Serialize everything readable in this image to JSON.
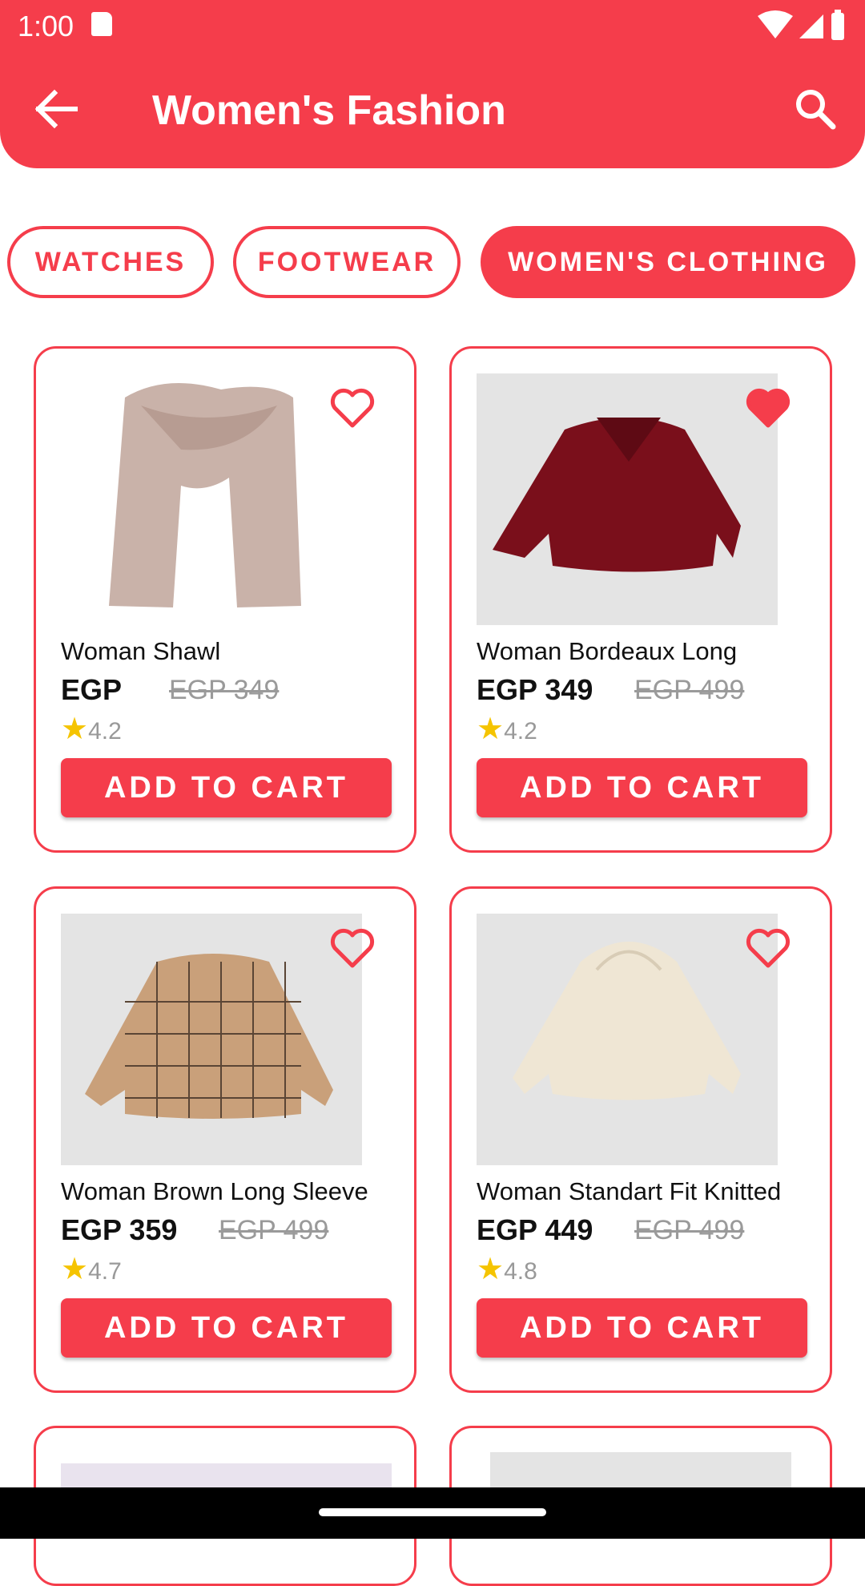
{
  "status": {
    "time": "1:00"
  },
  "header": {
    "title": "Women's Fashion"
  },
  "chips": [
    {
      "label": "WATCHES",
      "active": false
    },
    {
      "label": "FOOTWEAR",
      "active": false
    },
    {
      "label": "WOMEN'S CLOTHING",
      "active": true
    }
  ],
  "products": [
    {
      "name": "Woman Shawl",
      "price": "EGP",
      "old_price": "EGP 349",
      "rating": "4.2",
      "favorite": false,
      "button": "ADD TO CART",
      "image_color": "#c9b2a9"
    },
    {
      "name": "Woman Bordeaux Long",
      "price": "EGP 349",
      "old_price": "EGP 499",
      "rating": "4.2",
      "favorite": true,
      "button": "ADD TO CART",
      "image_color": "#7a0f1b"
    },
    {
      "name": "Woman Brown Long Sleeve",
      "price": "EGP 359",
      "old_price": "EGP 499",
      "rating": "4.7",
      "favorite": false,
      "button": "ADD TO CART",
      "image_color": "#c9a07a"
    },
    {
      "name": "Woman Standart Fit Knitted",
      "price": "EGP 449",
      "old_price": "EGP 499",
      "rating": "4.8",
      "favorite": false,
      "button": "ADD TO CART",
      "image_color": "#efe6d4"
    }
  ],
  "colors": {
    "accent": "#F53D4B",
    "star": "#F5C400"
  }
}
